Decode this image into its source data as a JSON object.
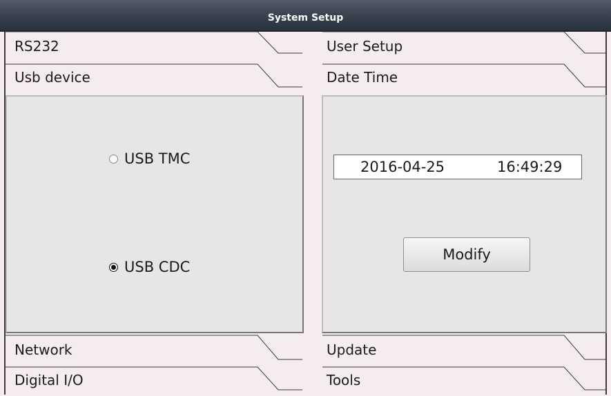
{
  "window": {
    "title": "System Setup"
  },
  "left_tabs": {
    "top": [
      "RS232",
      "Usb device"
    ],
    "bottom": [
      "Network",
      "Digital I/O"
    ]
  },
  "right_tabs": {
    "top": [
      "User Setup",
      "Date Time"
    ],
    "bottom": [
      "Update",
      "Tools"
    ]
  },
  "usb_panel": {
    "options": [
      {
        "label": "USB TMC",
        "selected": false
      },
      {
        "label": "USB CDC",
        "selected": true
      }
    ]
  },
  "datetime_panel": {
    "date": "2016-04-25",
    "time": "16:49:29",
    "modify_label": "Modify"
  }
}
